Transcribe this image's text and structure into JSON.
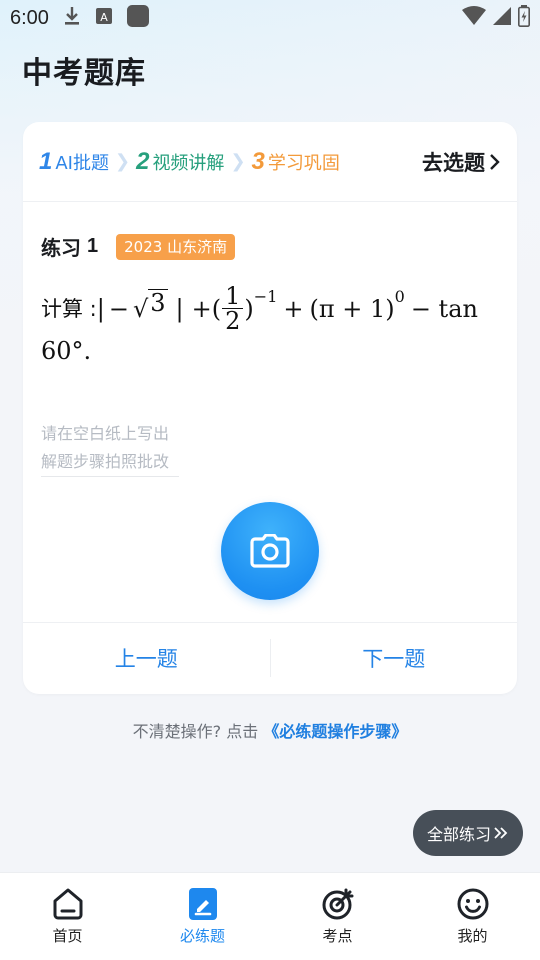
{
  "status_bar": {
    "time": "6:00",
    "icons": [
      "download-icon",
      "font-icon",
      "app-square-icon",
      "wifi-icon",
      "signal-icon",
      "battery-icon"
    ]
  },
  "page": {
    "title": "中考题库"
  },
  "steps": [
    {
      "num": "1",
      "label": "AI批题",
      "color": "#2f86e8"
    },
    {
      "num": "2",
      "label": "视频讲解",
      "color": "#27a07d"
    },
    {
      "num": "3",
      "label": "学习巩固",
      "color": "#f39a3a"
    }
  ],
  "select_button": {
    "label": "去选题"
  },
  "practice": {
    "label": "练习",
    "number": "1",
    "badge": "2023 山东济南",
    "badge_color": "#f7a04a"
  },
  "question": {
    "lead": "计算 :",
    "abs_open": "|",
    "minus": "−",
    "sqrt_radicand": "3",
    "abs_close": "|",
    "plus_paren": "+(",
    "frac_num": "1",
    "frac_den": "2",
    "paren_close": ")",
    "exp1": "−1",
    "plus2": "+",
    "pi_part": "(π + 1)",
    "exp2": "0",
    "minus_tan": "− tan",
    "line2": "60°."
  },
  "hint": {
    "line1": "请在空白纸上写出",
    "line2": "解题步骤拍照批改"
  },
  "camera": {
    "icon": "camera-icon",
    "color": "#1e90f2"
  },
  "nav": {
    "prev": "上一题",
    "next": "下一题"
  },
  "help": {
    "text": "不清楚操作? 点击",
    "link": "《必练题操作步骤》"
  },
  "all_practice": {
    "label": "全部练习"
  },
  "tabs": [
    {
      "label": "首页",
      "icon": "home-icon",
      "active": false
    },
    {
      "label": "必练题",
      "icon": "edit-note-icon",
      "active": true
    },
    {
      "label": "考点",
      "icon": "target-icon",
      "active": false
    },
    {
      "label": "我的",
      "icon": "smile-icon",
      "active": false
    }
  ]
}
